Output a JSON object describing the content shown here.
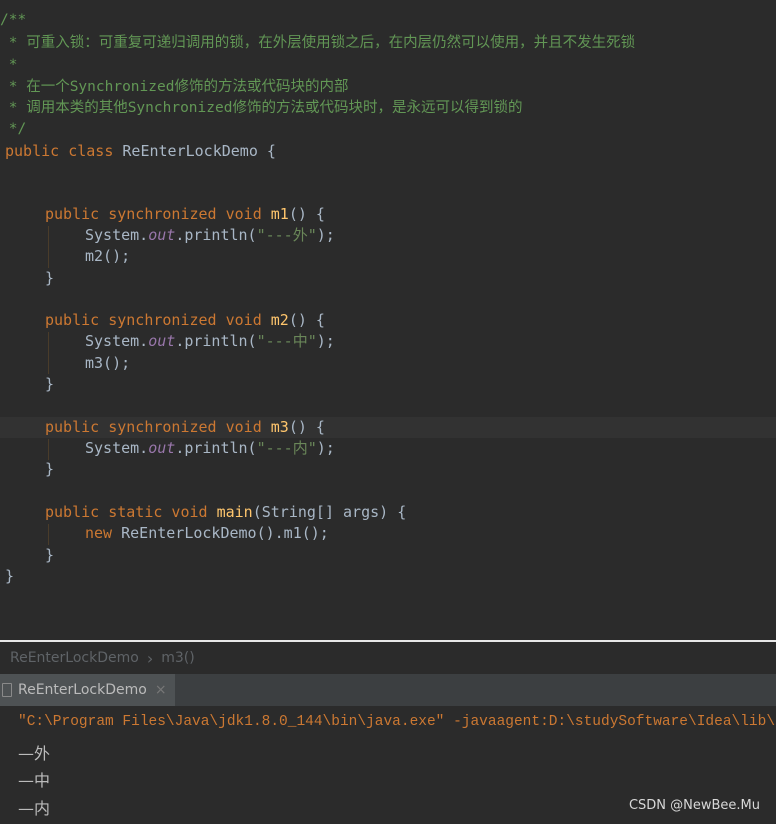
{
  "editor": {
    "comment_lines": [
      "/**",
      " * 可重入锁：可重复可递归调用的锁，在外层使用锁之后，在内层仍然可以使用，并且不发生死锁",
      " *",
      " * 在一个Synchronized修饰的方法或代码块的内部",
      " * 调用本类的其他Synchronized修饰的方法或代码块时，是永远可以得到锁的",
      " */"
    ],
    "class_kw": "public class",
    "class_name": "ReEnterLockDemo",
    "open_brace": " {",
    "method_kw": "public synchronized void",
    "static_kw": "public static void",
    "m1_name": "m1",
    "m2_name": "m2",
    "m3_name": "m3",
    "main_name": "main",
    "main_params": "(String[] args) {",
    "method_open": "() {",
    "system": "System.",
    "out": "out",
    "println": ".println(",
    "str_outer": "\"---外\"",
    "str_middle": "\"---中\"",
    "str_inner": "\"---内\"",
    "close_call": ");",
    "call_m2": "m2();",
    "call_m3": "m3();",
    "new_kw": "new",
    "new_call": " ReEnterLockDemo().m1();",
    "close_brace": "}"
  },
  "breadcrumb": {
    "class": "ReEnterLockDemo",
    "separator": "›",
    "method": "m3()"
  },
  "run_panel": {
    "tab_label": "ReEnterLockDemo",
    "close_glyph": "×"
  },
  "console": {
    "command": "\"C:\\Program Files\\Java\\jdk1.8.0_144\\bin\\java.exe\" -javaagent:D:\\studySoftware\\Idea\\lib\\",
    "outputs": [
      "—外",
      "—中",
      "—内"
    ]
  },
  "watermark": "CSDN @NewBee.Mu",
  "colors": {
    "background": "#2b2b2b",
    "keyword": "#cc7832",
    "comment": "#629755",
    "string": "#6a8759",
    "field": "#9876aa"
  }
}
